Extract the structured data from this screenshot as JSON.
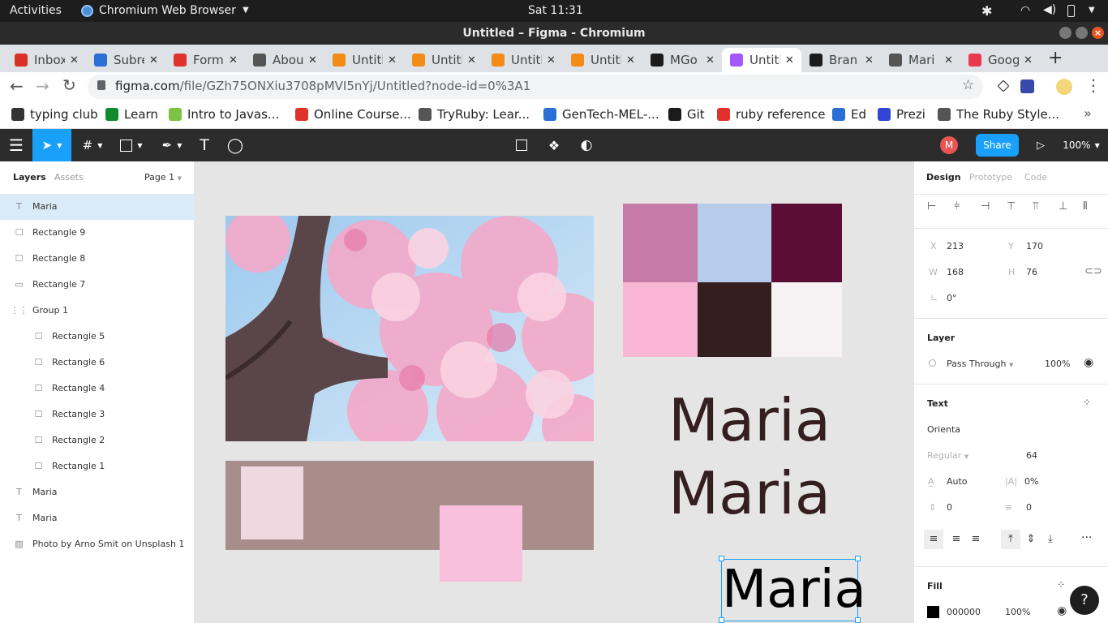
{
  "os": {
    "activities": "Activities",
    "app_name": "Chromium Web Browser",
    "clock": "Sat 11:31"
  },
  "window": {
    "title": "Untitled – Figma - Chromium"
  },
  "tabs": [
    {
      "title": "Inbox",
      "color": "#d93025"
    },
    {
      "title": "Subreddit",
      "color": "#2a6fd6"
    },
    {
      "title": "Forms",
      "color": "#e0322b"
    },
    {
      "title": "About",
      "color": "#555555"
    },
    {
      "title": "Untitled",
      "color": "#f28c16"
    },
    {
      "title": "Untitled",
      "color": "#f28c16"
    },
    {
      "title": "Untitled",
      "color": "#f28c16"
    },
    {
      "title": "Untitled",
      "color": "#f28c16"
    },
    {
      "title": "MGo",
      "color": "#1b1b1b"
    },
    {
      "title": "Untitled",
      "color": "#a259ff",
      "active": true
    },
    {
      "title": "Bran",
      "color": "#1b1b1b"
    },
    {
      "title": "Mari",
      "color": "#555555"
    },
    {
      "title": "Goog",
      "color": "#e8394d"
    }
  ],
  "address": {
    "host": "figma.com",
    "path": "/file/GZh75ONXiu3708pMVI5nYj/Untitled?node-id=0%3A1"
  },
  "bookmarks": [
    {
      "label": "typing club",
      "color": "#333333"
    },
    {
      "label": "Learn",
      "color": "#0f8a2e"
    },
    {
      "label": "Intro to Javas...",
      "color": "#7dc242"
    },
    {
      "label": "Online Course...",
      "color": "#e0322b"
    },
    {
      "label": "TryRuby: Lear...",
      "color": "#555555"
    },
    {
      "label": "GenTech-MEL-...",
      "color": "#2a6fd6"
    },
    {
      "label": "Git",
      "color": "#1b1b1b"
    },
    {
      "label": "ruby reference",
      "color": "#e0322b"
    },
    {
      "label": "Ed",
      "color": "#2a6fd6"
    },
    {
      "label": "Prezi",
      "color": "#3346d3"
    },
    {
      "label": "The Ruby Style...",
      "color": "#555555"
    }
  ],
  "figma_toolbar": {
    "share_label": "Share",
    "zoom": "100%",
    "avatar_initial": "M"
  },
  "left_panel": {
    "tabs": {
      "layers": "Layers",
      "assets": "Assets"
    },
    "page": "Page 1",
    "layers": [
      {
        "name": "Maria",
        "type": "text",
        "selected": true
      },
      {
        "name": "Rectangle 9",
        "type": "rect"
      },
      {
        "name": "Rectangle 8",
        "type": "rect"
      },
      {
        "name": "Rectangle 7",
        "type": "line"
      },
      {
        "name": "Group 1",
        "type": "group"
      },
      {
        "name": "Rectangle 5",
        "type": "rect",
        "indent": true
      },
      {
        "name": "Rectangle 6",
        "type": "rect",
        "indent": true
      },
      {
        "name": "Rectangle 4",
        "type": "rect",
        "indent": true
      },
      {
        "name": "Rectangle 3",
        "type": "rect",
        "indent": true
      },
      {
        "name": "Rectangle 2",
        "type": "rect",
        "indent": true
      },
      {
        "name": "Rectangle 1",
        "type": "rect",
        "indent": true
      },
      {
        "name": "Maria",
        "type": "text"
      },
      {
        "name": "Maria",
        "type": "text"
      },
      {
        "name": "Photo by Arno Smit on Unsplash 1",
        "type": "image"
      }
    ]
  },
  "canvas": {
    "text1": "Maria",
    "text2": "Maria",
    "text3": "Maria",
    "palette": [
      "#c67aa8",
      "#b7cbea",
      "#5c0d35",
      "#f9b6d5",
      "#341e1f",
      "#f7f3f4"
    ],
    "strip_color": "#a88e8a",
    "swatch_a": "#f0d8e0",
    "swatch_b": "#f8c0dc"
  },
  "right_panel": {
    "tabs": {
      "design": "Design",
      "prototype": "Prototype",
      "code": "Code"
    },
    "x_label": "X",
    "x": "213",
    "y_label": "Y",
    "y": "170",
    "w_label": "W",
    "w": "168",
    "h_label": "H",
    "h": "76",
    "rotation": "0°",
    "layer_title": "Layer",
    "blend_mode": "Pass Through",
    "opacity": "100%",
    "text_title": "Text",
    "font_family": "Orienta",
    "font_weight": "Regular",
    "font_size": "64",
    "line_height": "Auto",
    "letter_spacing": "0%",
    "paragraph_spacing": "0",
    "paragraph_indent": "0",
    "fill_title": "Fill",
    "fill_hex": "000000",
    "fill_opacity": "100%"
  }
}
